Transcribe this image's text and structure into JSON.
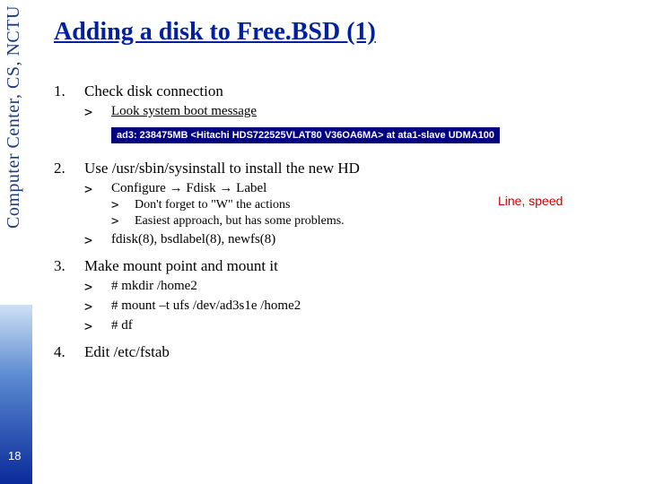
{
  "sidebar": {
    "label": "Computer Center, CS, NCTU"
  },
  "page_number": "18",
  "title": "Adding a disk to Free.BSD (1)",
  "annotation": "Line, speed",
  "items": [
    {
      "num": "1.",
      "text": "Check disk connection",
      "sub": [
        {
          "marker": ">",
          "text": "Look system boot message",
          "underline": true
        }
      ],
      "code": "ad3: 238475MB <Hitachi HDS722525VLAT80 V36OA6MA> at ata1-slave UDMA100"
    },
    {
      "num": "2.",
      "text": "Use /usr/sbin/sysinstall to install the new HD",
      "sub": [
        {
          "marker": ">",
          "text": "Configure → Fdisk → Label",
          "sub": [
            {
              "marker": ">",
              "text": "Don't forget to \"W\" the actions"
            },
            {
              "marker": ">",
              "text": "Easiest approach, but has some problems."
            }
          ]
        },
        {
          "marker": ">",
          "text": "fdisk(8), bsdlabel(8), newfs(8)"
        }
      ]
    },
    {
      "num": "3.",
      "text": "Make mount point and mount it",
      "sub": [
        {
          "marker": ">",
          "text": "# mkdir /home2"
        },
        {
          "marker": ">",
          "text": "# mount –t ufs /dev/ad3s1e /home2"
        },
        {
          "marker": ">",
          "text": "# df"
        }
      ]
    },
    {
      "num": "4.",
      "text": "Edit /etc/fstab"
    }
  ]
}
